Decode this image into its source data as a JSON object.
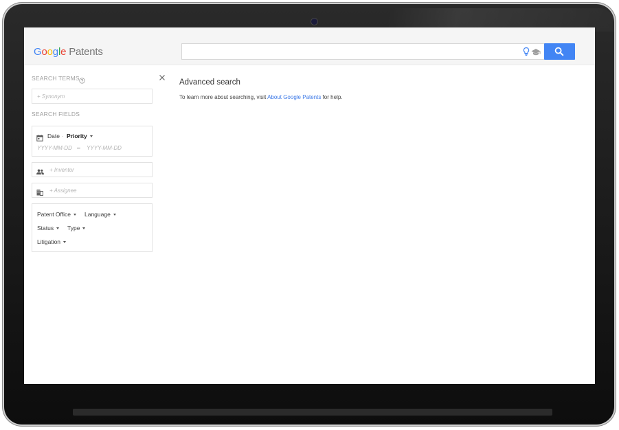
{
  "logo": {
    "letters": [
      "G",
      "o",
      "o",
      "g",
      "l",
      "e"
    ],
    "product": "Patents"
  },
  "search": {
    "value": "",
    "placeholder": ""
  },
  "sidebar": {
    "search_terms_label": "SEARCH TERMS",
    "synonym_placeholder": "+ Synonym",
    "search_fields_label": "SEARCH FIELDS",
    "date": {
      "label": "Date",
      "separator": "·",
      "type_value": "Priority",
      "from_placeholder": "YYYY-MM-DD",
      "dash": "–",
      "to_placeholder": "YYYY-MM-DD"
    },
    "inventor_placeholder": "+ Inventor",
    "assignee_placeholder": "+ Assignee",
    "filters": {
      "patent_office": "Patent Office",
      "language": "Language",
      "status": "Status",
      "type": "Type",
      "litigation": "Litigation"
    }
  },
  "main": {
    "title": "Advanced search",
    "help_prefix": "To learn more about searching, visit ",
    "help_link": "About Google Patents",
    "help_suffix": " for help."
  },
  "colors": {
    "accent": "#4285f4",
    "link": "#3b78e7",
    "header_bg": "#f5f5f5"
  },
  "icons": [
    "search-icon",
    "lightbulb-icon",
    "graduation-cap-icon",
    "help-icon",
    "close-icon",
    "calendar-icon",
    "people-icon",
    "building-icon",
    "caret-down-icon"
  ]
}
